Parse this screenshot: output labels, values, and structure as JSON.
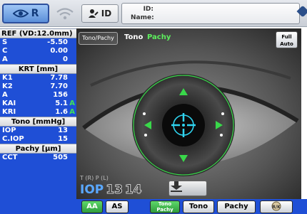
{
  "top": {
    "eye_button": "R",
    "id_button": "ID",
    "patient_id_label": "ID:",
    "patient_name_label": "Name:"
  },
  "ref": {
    "header": "REF (VD:12.0mm)",
    "rows": [
      {
        "key": "S",
        "value": "-5.50"
      },
      {
        "key": "C",
        "value": "0.00"
      },
      {
        "key": "A",
        "value": "0"
      }
    ]
  },
  "krt": {
    "header": "KRT [mm]",
    "rows": [
      {
        "key": "K1",
        "value": "7.78",
        "flag": ""
      },
      {
        "key": "K2",
        "value": "7.70",
        "flag": ""
      },
      {
        "key": "A",
        "value": "156",
        "flag": ""
      },
      {
        "key": "KAI",
        "value": "5.1",
        "flag": "A"
      },
      {
        "key": "KRI",
        "value": "1.6",
        "flag": "A"
      }
    ]
  },
  "tono": {
    "header": "Tono [mmHg]",
    "rows": [
      {
        "key": "IOP",
        "value": "13"
      },
      {
        "key": "C.IOP",
        "value": "15"
      }
    ]
  },
  "pachy": {
    "header": "Pachy [µm]",
    "rows": [
      {
        "key": "CCT",
        "value": "505"
      }
    ]
  },
  "viewport": {
    "mode_button": "Tono/Pachy",
    "mode_tono": "Tono",
    "mode_pachy": "Pachy",
    "full_auto": [
      "Full",
      "Auto"
    ],
    "iop_lr": "T (R) P (L)",
    "iop_label": "IOP",
    "iop_r": "13",
    "iop_l": "14"
  },
  "bottom": {
    "aa": "AA",
    "as": "AS",
    "tono_pachy": [
      "Tono",
      "Pachy"
    ],
    "tono": "Tono",
    "pachy": "Pachy",
    "rk": "R/K"
  },
  "colors": {
    "panel_blue": "#1f4fd6",
    "accent_green": "#3fe05a",
    "reticle_cyan": "#2fd4f0"
  }
}
